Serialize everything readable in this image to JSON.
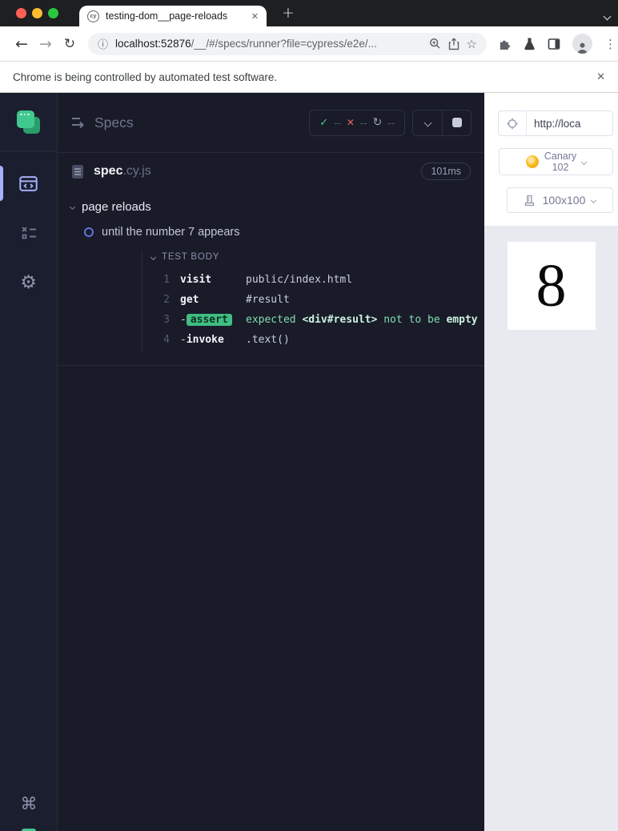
{
  "chrome": {
    "tab_title": "testing-dom__page-reloads",
    "favicon_label": "cy",
    "new_tab_glyph": "+",
    "url_host": "localhost:52876",
    "url_path": "/__/#/specs/runner?file=cypress/e2e/...",
    "infobar_message": "Chrome is being controlled by automated test software.",
    "glyphs": {
      "back": "←",
      "forward": "→",
      "reload": "↻",
      "info": "ⓘ",
      "star": "☆",
      "close": "✕",
      "dots": "⋮"
    }
  },
  "sidebar": {
    "glyphs": {
      "settings": "⚙",
      "shortcuts": "⌘"
    }
  },
  "reporter": {
    "title": "Specs",
    "stats": {
      "passed": "--",
      "failed": "--",
      "pending": "--"
    },
    "stat_glyphs": {
      "passed": "✓",
      "failed": "✕",
      "pending": "↻"
    },
    "spec_file": {
      "base": "spec",
      "ext": ".cy.js",
      "duration": "101ms"
    },
    "suite_title": "page reloads",
    "test_title": "until the number 7 appears",
    "section_label": "TEST BODY",
    "commands": [
      {
        "num": "1",
        "prefix": "",
        "name": "visit",
        "message": "public/index.html"
      },
      {
        "num": "2",
        "prefix": "",
        "name": "get",
        "message": "#result"
      },
      {
        "num": "3",
        "prefix": "-",
        "name": "assert",
        "msg_p1": "expected ",
        "msg_p2": "<div#result>",
        "msg_p3": " not to be ",
        "msg_p4": "empty"
      },
      {
        "num": "4",
        "prefix": "-",
        "name": "invoke",
        "message": ".text()"
      }
    ]
  },
  "aut": {
    "url_text": "http://loca",
    "browser_line1": "Canary",
    "browser_line2": "102",
    "viewport": "100x100",
    "app_content": "8"
  },
  "colors": {
    "traffic_red": "#ff5f57",
    "traffic_yellow": "#febc2e",
    "traffic_green": "#2ac840",
    "pass_green": "#3ecf8e",
    "fail_red": "#e9636d",
    "pending_gray": "#9aa0b8",
    "assert_badge_bg": "#40bd83",
    "accent_lavender": "#a5b1f9",
    "running_ring": "#6470e0",
    "sidebar_bg": "#1b1e2e",
    "reporter_bg": "#191b28",
    "aut_bg": "#e9eaf0",
    "canary_amber": "#f0a30a"
  }
}
